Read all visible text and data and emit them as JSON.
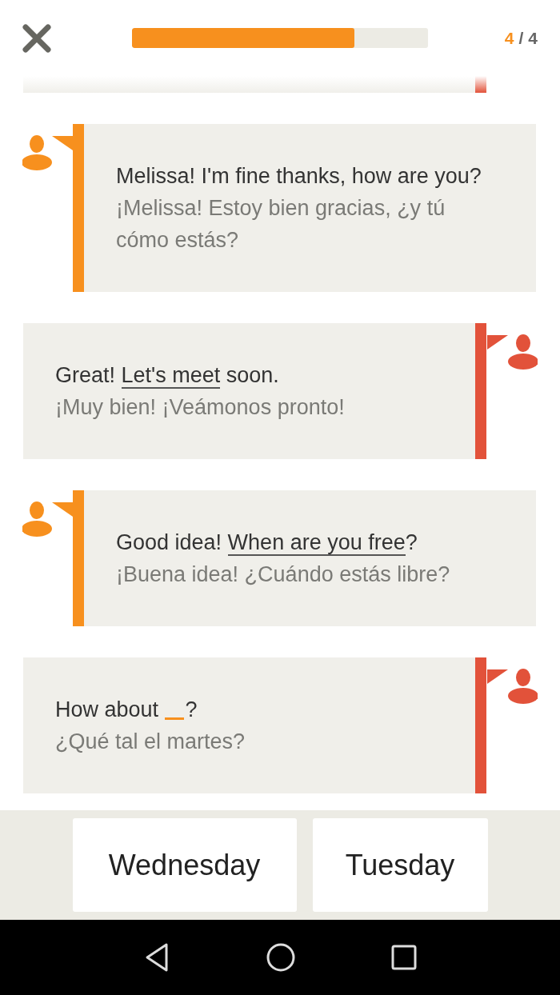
{
  "header": {
    "progress": {
      "level": 0.75
    },
    "counter": {
      "current": "4",
      "separator": "/",
      "total": "4"
    }
  },
  "messages": [
    {
      "kind": "right",
      "partial": true
    },
    {
      "kind": "left",
      "partial": false,
      "english": [
        {
          "kind": "text",
          "text": "Melissa! I'm fine thanks, how are you?"
        }
      ],
      "spanish": "¡Melissa! Estoy bien gracias, ¿y tú cómo estás?"
    },
    {
      "kind": "right",
      "partial": false,
      "english": [
        {
          "kind": "text",
          "text": "Great! "
        },
        {
          "kind": "phrase",
          "text": "Let's meet"
        },
        {
          "kind": "text",
          "text": " soon."
        }
      ],
      "spanish": "¡Muy bien! ¡Veámonos pronto!"
    },
    {
      "kind": "left",
      "partial": false,
      "english": [
        {
          "kind": "text",
          "text": "Good idea! "
        },
        {
          "kind": "phrase",
          "text": "When are you free"
        },
        {
          "kind": "text",
          "text": "?"
        }
      ],
      "spanish": "¡Buena idea! ¿Cuándo estás libre?"
    },
    {
      "kind": "right",
      "partial": false,
      "english": [
        {
          "kind": "text",
          "text": "How about "
        },
        {
          "kind": "blank"
        },
        {
          "kind": "text",
          "text": "?"
        }
      ],
      "spanish": "¿Qué tal el martes?"
    }
  ],
  "options": [
    "Wednesday",
    "Tuesday"
  ]
}
